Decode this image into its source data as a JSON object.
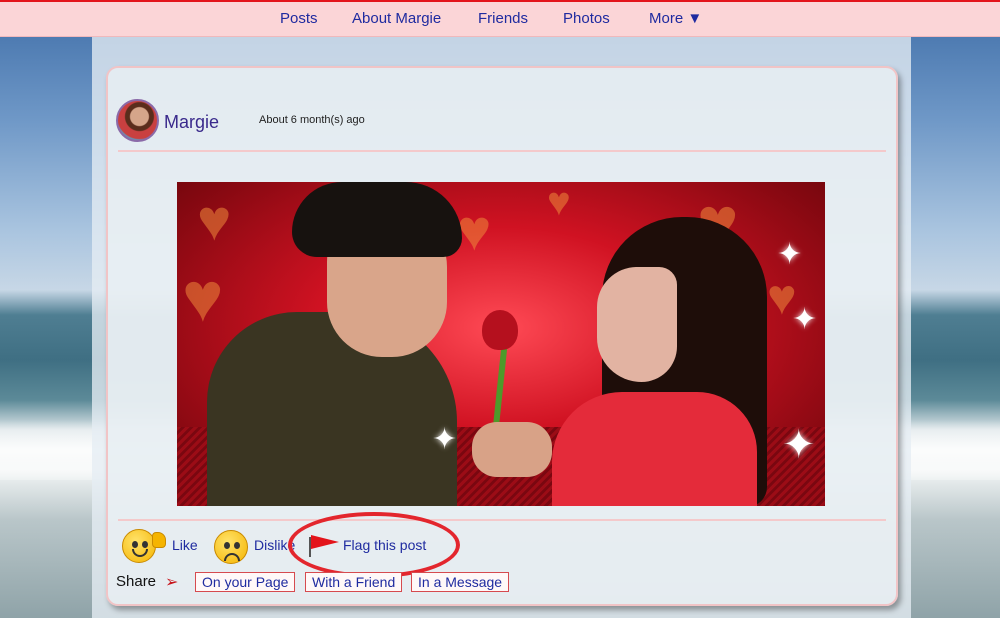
{
  "nav": {
    "items": [
      "Posts",
      "About Margie",
      "Friends",
      "Photos"
    ],
    "more_label": "More ▼"
  },
  "post": {
    "author": "Margie",
    "timestamp": "About 6 month(s) ago"
  },
  "actions": {
    "like_label": "Like",
    "dislike_label": "Dislike",
    "flag_label": "Flag this post"
  },
  "share": {
    "label": "Share",
    "options": [
      "On your Page",
      "With a Friend",
      "In a Message"
    ]
  },
  "colors": {
    "nav_bg": "#fbd5d7",
    "link": "#1f2ba0",
    "highlight_circle": "#e3262d"
  }
}
